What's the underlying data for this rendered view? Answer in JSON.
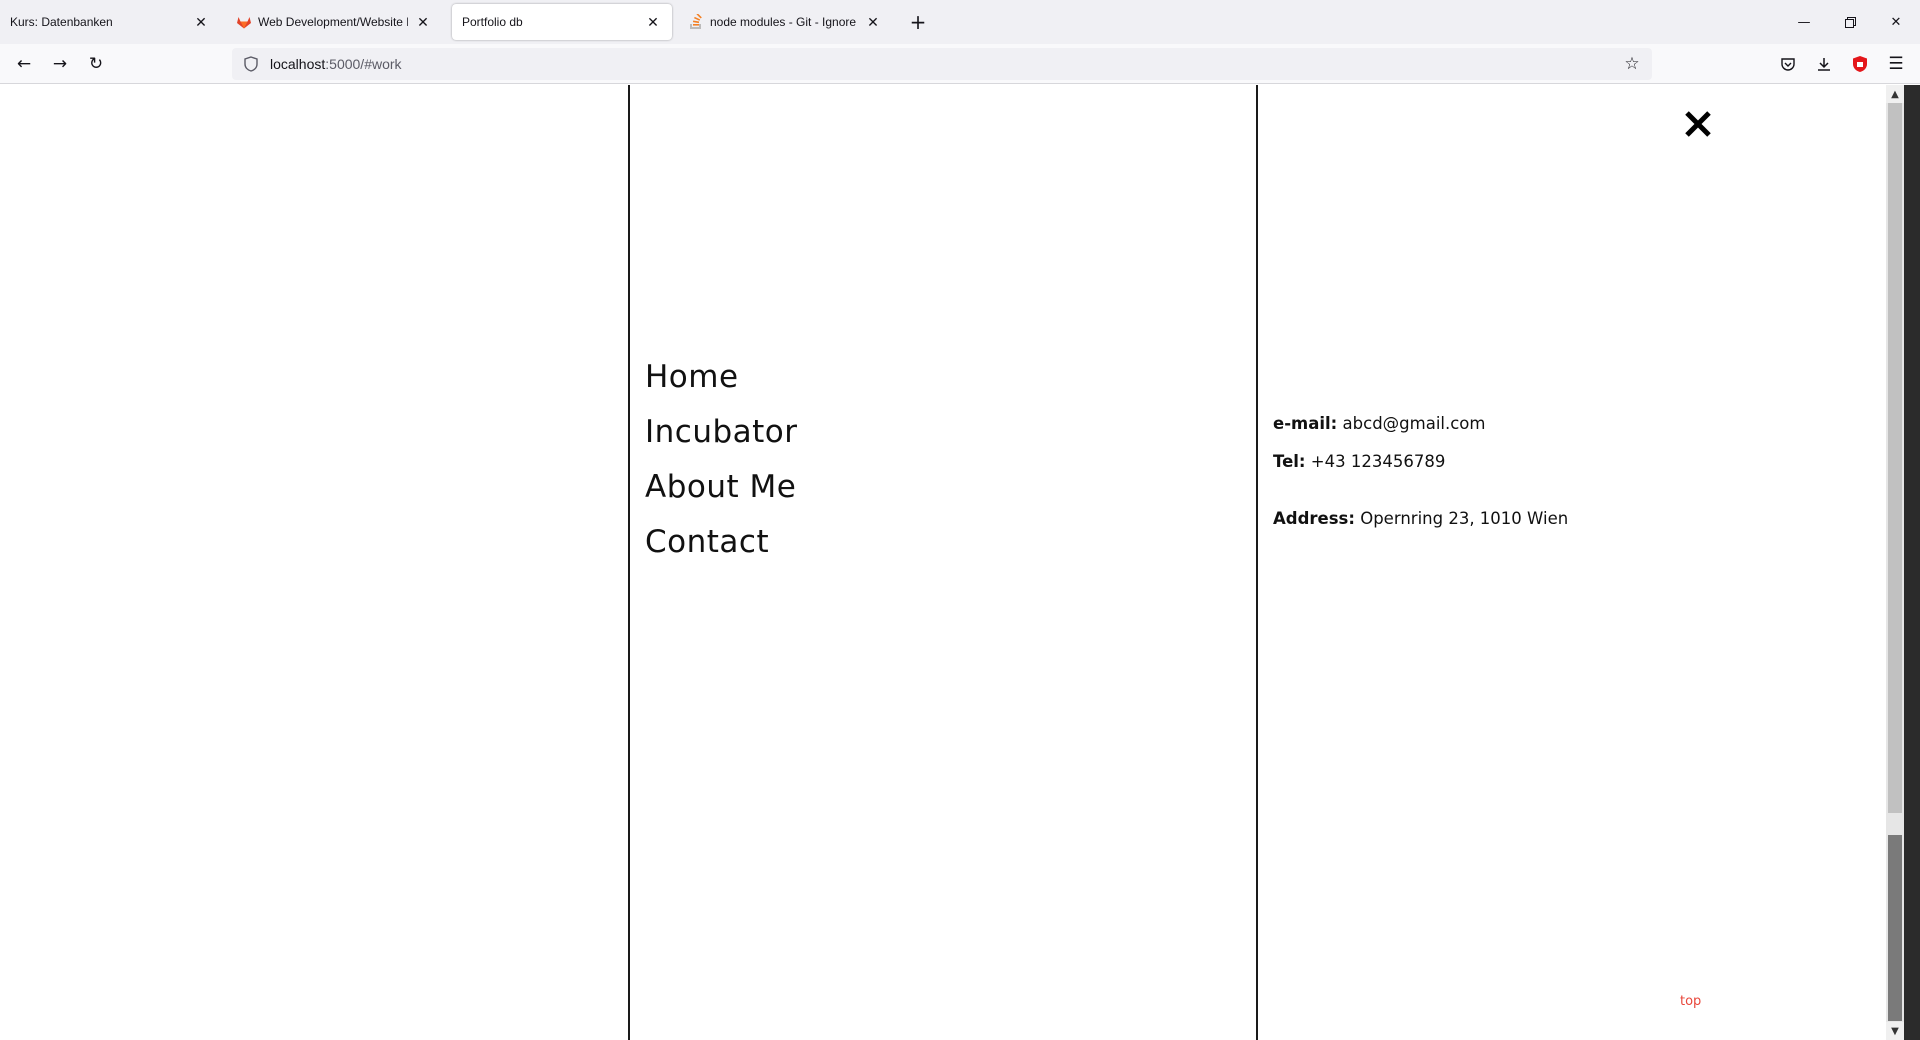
{
  "browser": {
    "tabs": [
      {
        "title": "Kurs: Datenbanken",
        "active": false
      },
      {
        "title": "Web Development/Website Hin",
        "active": false
      },
      {
        "title": "Portfolio db",
        "active": true
      },
      {
        "title": "node modules - Git - Ignore no",
        "active": false
      }
    ],
    "url_host": "localhost",
    "url_path": ":5000/#work"
  },
  "menu": {
    "items": [
      "Home",
      "Incubator",
      "About Me",
      "Contact"
    ]
  },
  "contact": {
    "email_label": "e-mail:",
    "email_value": "abcd@gmail.com",
    "tel_label": "Tel:",
    "tel_value": "+43 123456789",
    "address_label": "Address:",
    "address_value": "Opernring 23, 1010 Wien"
  },
  "footer": {
    "top_label": "top"
  },
  "colors": {
    "accent_top_link": "#e8473b",
    "divider": "#1a1a1a"
  }
}
